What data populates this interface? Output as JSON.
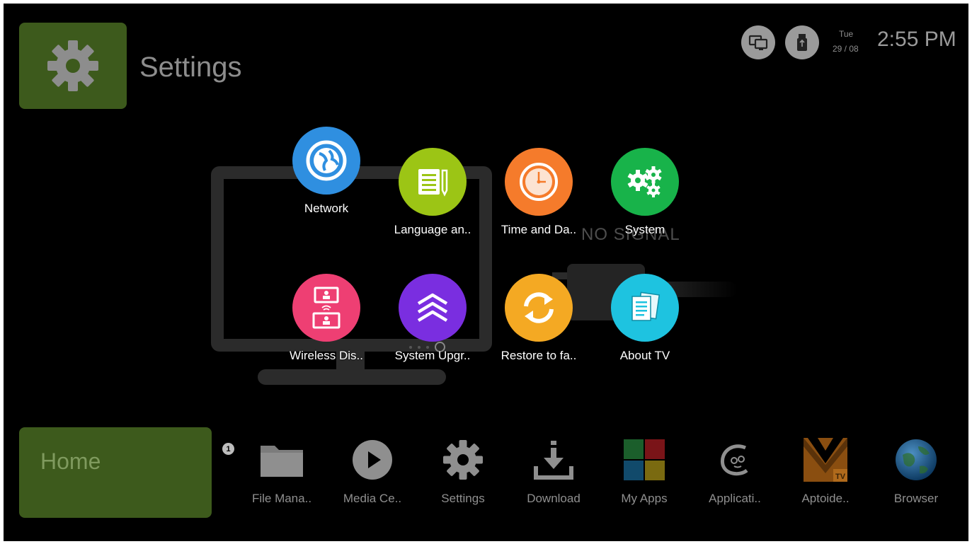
{
  "header": {
    "title": "Settings"
  },
  "status": {
    "day": "Tue",
    "date": "29 / 08",
    "time": "2:55 PM"
  },
  "background": {
    "no_signal": "NO SIGNAL"
  },
  "settings_items": [
    {
      "label": "Network",
      "icon": "network-globe-icon",
      "color": "#2f8fe0"
    },
    {
      "label": "Language an..",
      "icon": "language-notepad-icon",
      "color": "#9cc515"
    },
    {
      "label": "Time and Da..",
      "icon": "clock-icon",
      "color": "#f57b2b"
    },
    {
      "label": "System",
      "icon": "gears-icon",
      "color": "#18b34a"
    },
    {
      "label": "Wireless Dis..",
      "icon": "wireless-display-icon",
      "color": "#ee3f73"
    },
    {
      "label": "System Upgr..",
      "icon": "upgrade-chevrons-icon",
      "color": "#7a2ee0"
    },
    {
      "label": "Restore to fa..",
      "icon": "restore-arrows-icon",
      "color": "#f4a923"
    },
    {
      "label": "About TV",
      "icon": "document-icon",
      "color": "#1ec3e0"
    }
  ],
  "home": {
    "label": "Home",
    "badge": "1"
  },
  "dock": [
    {
      "label": "File Mana..",
      "icon": "folder-icon"
    },
    {
      "label": "Media Ce..",
      "icon": "play-icon"
    },
    {
      "label": "Settings",
      "icon": "gear-icon"
    },
    {
      "label": "Download",
      "icon": "download-icon"
    },
    {
      "label": "My Apps",
      "icon": "apps-grid-icon"
    },
    {
      "label": "Applicati..",
      "icon": "application-logo-icon"
    },
    {
      "label": "Aptoide..",
      "icon": "aptoide-icon"
    },
    {
      "label": "Browser",
      "icon": "globe-icon"
    }
  ]
}
